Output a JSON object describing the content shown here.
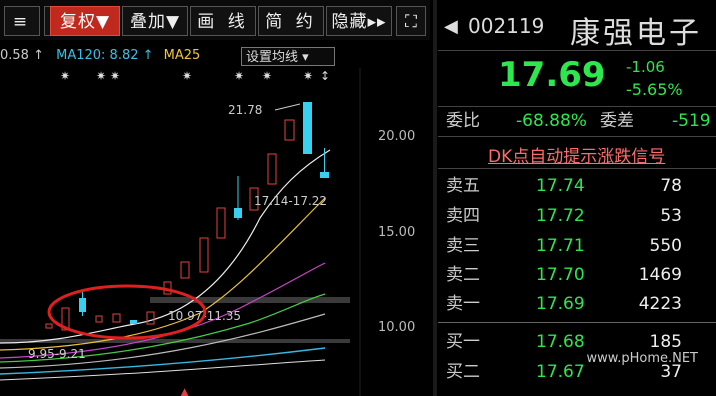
{
  "toolbar": {
    "minus": "—",
    "restore": "复权▼",
    "overlay": "叠加▼",
    "draw": "画 线",
    "simple": "简 约",
    "hide": "隐藏▸▸"
  },
  "ma_bar": {
    "ma_a": "0.58 ↑",
    "ma120": "MA120: 8.82 ↑",
    "ma250": "MA25",
    "set_ma": "设置均线 ▾"
  },
  "chart_data": {
    "type": "candlestick",
    "y_ticks": [
      "20.00",
      "15.00",
      "10.00"
    ],
    "annotations": {
      "high_label": "21.78",
      "range1": "17.14-17.22",
      "range2": "10.97-11.35",
      "range3": "9.95-9.21"
    }
  },
  "quote": {
    "code": "002119",
    "name": "康强电子",
    "price": "17.69",
    "change": "-1.06",
    "change_pct": "-5.65%",
    "weibi_label": "委比",
    "weibi": "-68.88%",
    "weicha_label": "委差",
    "weicha": "-519",
    "dk_link": "DK点自动提示涨跌信号",
    "asks": [
      {
        "label": "卖五",
        "price": "17.74",
        "vol": "78"
      },
      {
        "label": "卖四",
        "price": "17.72",
        "vol": "53"
      },
      {
        "label": "卖三",
        "price": "17.71",
        "vol": "550"
      },
      {
        "label": "卖二",
        "price": "17.70",
        "vol": "1469"
      },
      {
        "label": "卖一",
        "price": "17.69",
        "vol": "4223"
      }
    ],
    "bids": [
      {
        "label": "买一",
        "price": "17.68",
        "vol": "185"
      },
      {
        "label": "买二",
        "price": "17.67",
        "vol": "37"
      }
    ]
  },
  "watermark": "www.pHome.NET"
}
